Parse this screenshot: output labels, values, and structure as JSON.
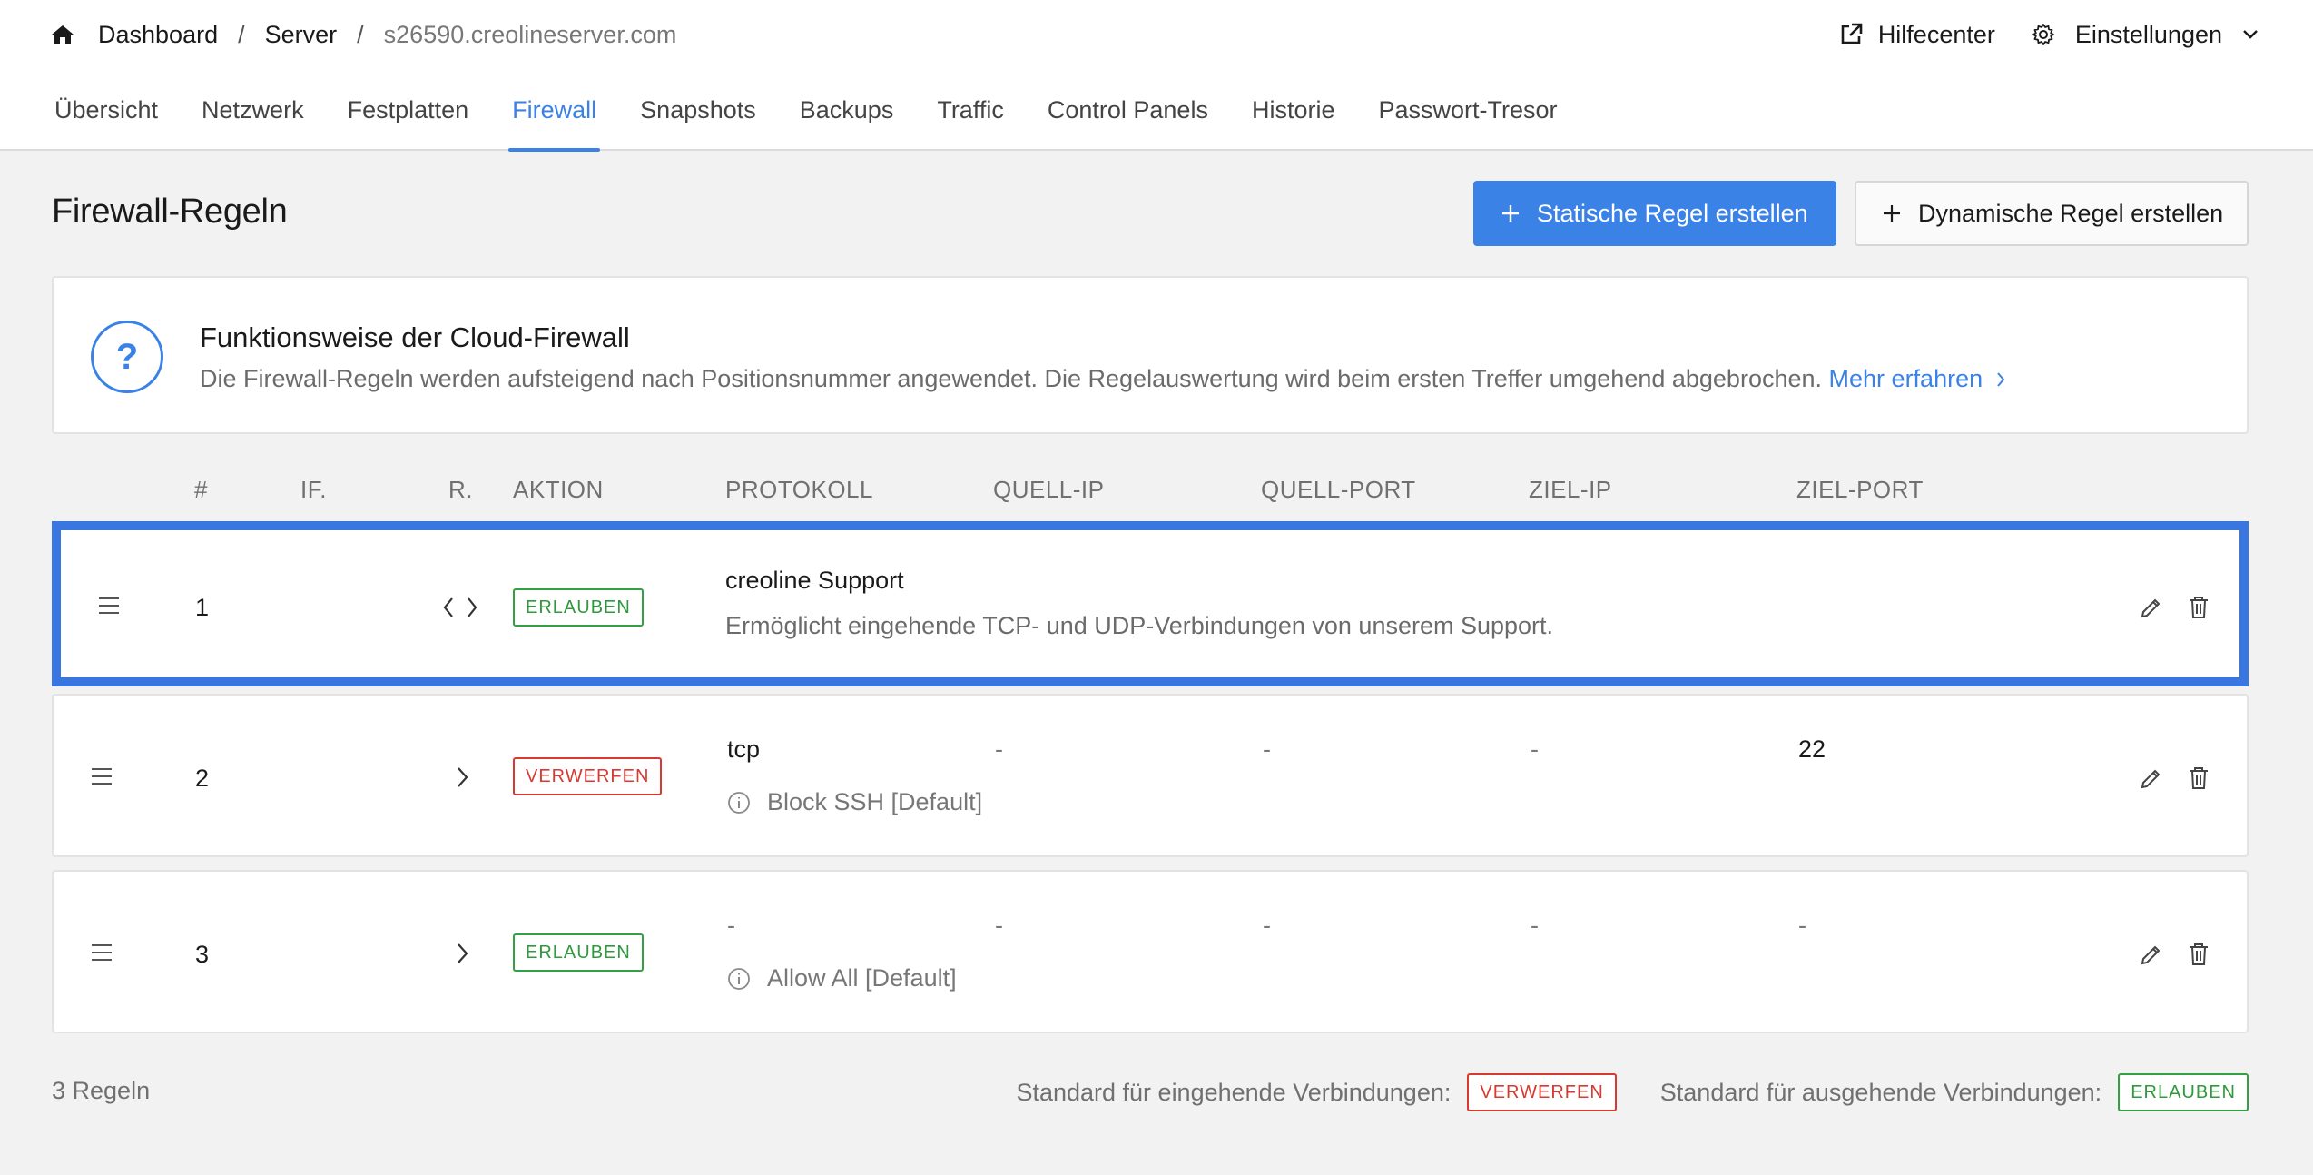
{
  "breadcrumb": {
    "home_icon": "home-icon",
    "items": [
      "Dashboard",
      "Server",
      "s26590.creolineserver.com"
    ],
    "separator": "/"
  },
  "top_right": {
    "help_label": "Hilfecenter",
    "help_icon": "external-link-icon",
    "settings_label": "Einstellungen",
    "settings_icon": "gear-icon"
  },
  "tabs": [
    {
      "label": "Übersicht",
      "active": false
    },
    {
      "label": "Netzwerk",
      "active": false
    },
    {
      "label": "Festplatten",
      "active": false
    },
    {
      "label": "Firewall",
      "active": true
    },
    {
      "label": "Snapshots",
      "active": false
    },
    {
      "label": "Backups",
      "active": false
    },
    {
      "label": "Traffic",
      "active": false
    },
    {
      "label": "Control Panels",
      "active": false
    },
    {
      "label": "Historie",
      "active": false
    },
    {
      "label": "Passwort-Tresor",
      "active": false
    }
  ],
  "page": {
    "title": "Firewall-Regeln",
    "primary_button": "Statische Regel erstellen",
    "secondary_button": "Dynamische Regel erstellen"
  },
  "info": {
    "icon": "?",
    "title": "Funktionsweise der Cloud-Firewall",
    "text": "Die Firewall-Regeln werden aufsteigend nach Positionsnummer angewendet. Die Regelauswertung wird beim ersten Treffer umgehend abgebrochen.",
    "link": "Mehr erfahren"
  },
  "table": {
    "headers": [
      "#",
      "IF.",
      "R.",
      "AKTION",
      "PROTOKOLL",
      "QUELL-IP",
      "QUELL-PORT",
      "ZIEL-IP",
      "ZIEL-PORT"
    ],
    "rows": [
      {
        "position": "1",
        "direction_icon": "bidirectional-arrows-icon",
        "action": "ERLAUBEN",
        "title": "creoline Support",
        "description": "Ermöglicht eingehende TCP- und UDP-Verbindungen von unserem Support."
      },
      {
        "position": "2",
        "direction_icon": "chevron-right-icon",
        "action": "VERWERFEN",
        "protocol": "tcp",
        "source_ip": "-",
        "source_port": "-",
        "dest_ip": "-",
        "dest_port": "22",
        "note": "Block SSH [Default]"
      },
      {
        "position": "3",
        "direction_icon": "chevron-right-icon",
        "action": "ERLAUBEN",
        "protocol": "-",
        "source_ip": "-",
        "source_port": "-",
        "dest_ip": "-",
        "dest_port": "-",
        "note": "Allow All [Default]"
      }
    ]
  },
  "footer": {
    "count": "3 Regeln",
    "inbound_label": "Standard für eingehende Verbindungen:",
    "inbound_value": "VERWERFEN",
    "outbound_label": "Standard für ausgehende Verbindungen:",
    "outbound_value": "ERLAUBEN"
  },
  "colors": {
    "accent": "#3b82e6",
    "allow": "#34a043",
    "drop": "#d63a31",
    "selection": "#3a76e0"
  }
}
